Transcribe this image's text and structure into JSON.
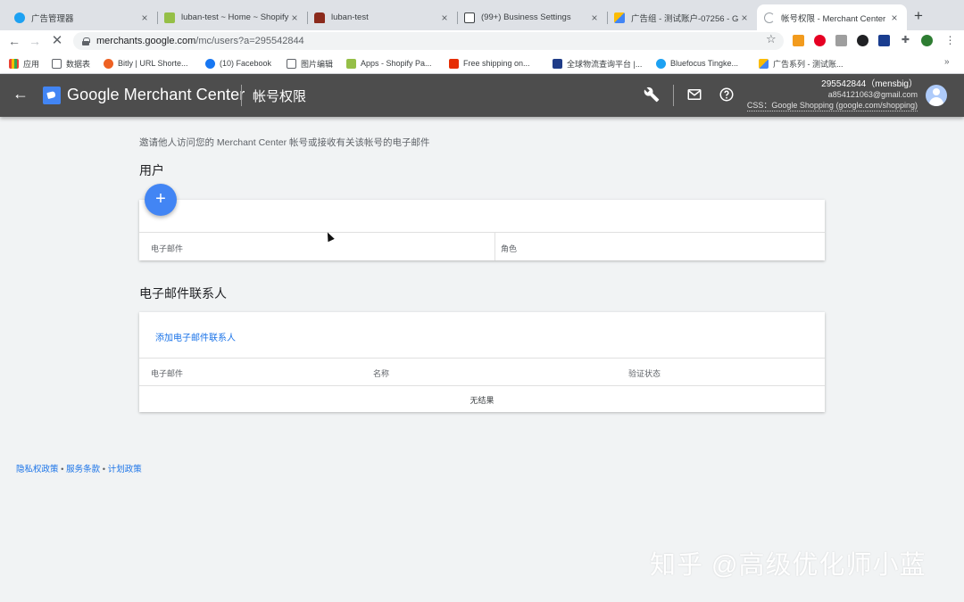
{
  "browser": {
    "tabs": [
      {
        "title": "广告管理器",
        "favicon": "twitter-icon"
      },
      {
        "title": "luban-test ~ Home ~ Shopify",
        "favicon": "shopify-icon"
      },
      {
        "title": "luban-test",
        "favicon": "store-hat-icon"
      },
      {
        "title": "(99+) Business Settings",
        "favicon": "facebook-business-icon"
      },
      {
        "title": "广告组 - 测试账户-07256 - G",
        "favicon": "google-ads-icon"
      },
      {
        "title": "帐号权限 - Merchant Center",
        "favicon": "loading-spinner-icon",
        "active": true
      }
    ],
    "new_tab_label": "+",
    "close_glyph": "×",
    "url_host": "merchants.google.com",
    "url_path": "/mc/users?a=295542844",
    "bookmarks": [
      {
        "label": "应用",
        "icon": "apps-grid-icon"
      },
      {
        "label": "数据表",
        "icon": "folder-icon"
      },
      {
        "label": "Bitly | URL Shorte...",
        "icon": "bitly-icon"
      },
      {
        "label": "(10) Facebook",
        "icon": "facebook-icon"
      },
      {
        "label": "图片编辑",
        "icon": "folder-icon"
      },
      {
        "label": "Apps - Shopify Pa...",
        "icon": "shopify-icon"
      },
      {
        "label": "Free shipping on...",
        "icon": "aliexpress-icon"
      },
      {
        "label": "全球物流查询平台 |...",
        "icon": "17track-icon"
      },
      {
        "label": "Bluefocus Tingke...",
        "icon": "twitter-icon"
      },
      {
        "label": "广告系列 - 测试账...",
        "icon": "google-ads-icon"
      }
    ],
    "more_bookmarks": "»"
  },
  "appbar": {
    "brand": "Google Merchant Center",
    "page_title": "帐号权限",
    "account_id": "295542844（mensbig）",
    "account_email": "a854121063@gmail.com",
    "account_css": "CSS：Google Shopping (google.com/shopping)"
  },
  "main": {
    "intro": "邀请他人访问您的 Merchant Center 帐号或接收有关该帐号的电子邮件",
    "users": {
      "title": "用户",
      "add_label": "+",
      "columns": [
        "电子邮件",
        "角色"
      ]
    },
    "email_contacts": {
      "title": "电子邮件联系人",
      "add_link": "添加电子邮件联系人",
      "columns": [
        "电子邮件",
        "名称",
        "验证状态"
      ],
      "empty_text": "无结果"
    }
  },
  "footer": {
    "links": [
      "隐私权政策",
      "服务条款",
      "计划政策"
    ],
    "separator": "•"
  },
  "watermark": "知乎 @高级优化师小蓝",
  "colors": {
    "appbar_bg": "#4d4d4d",
    "accent_blue": "#4285f4",
    "link_blue": "#1a73e8",
    "page_bg": "#f1f3f4"
  }
}
